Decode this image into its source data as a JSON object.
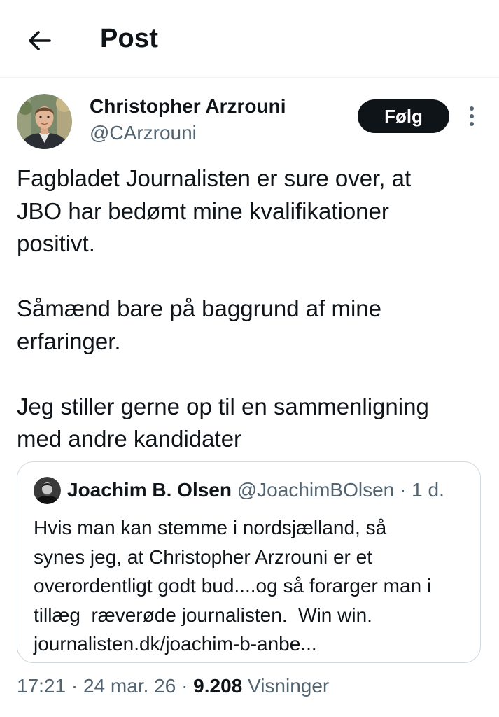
{
  "header": {
    "title": "Post",
    "back_icon": "arrow-left-icon"
  },
  "author": {
    "name": "Christopher Arzrouni",
    "handle": "@CArzrouni",
    "follow_label": "Følg",
    "more_icon": "more-vertical-icon"
  },
  "post": {
    "paragraphs": [
      {
        "lines": [
          "Fagbladet Journalisten er sure over, at",
          "JBO har bedømt mine kvalifikationer",
          "positivt."
        ]
      },
      {
        "lines": [
          "Såmænd bare på baggrund af mine",
          "erfaringer."
        ]
      },
      {
        "lines": [
          "Jeg stiller gerne op til en sammenligning",
          "med andre kandidater"
        ]
      }
    ]
  },
  "quote": {
    "name": "Joachim B. Olsen",
    "handle": "@JoachimBOlsen",
    "separator": "·",
    "time": "1 d.",
    "lines": [
      "Hvis man kan stemme i nordsjælland, så",
      "synes jeg, at Christopher Arzrouni er et",
      "overordentligt godt bud....og så forarger man i",
      "tillæg  ræverøde journalisten.  Win win.",
      "journalisten.dk/joachim-b-anbe..."
    ]
  },
  "meta": {
    "time": "17:21",
    "separator": "·",
    "date": "24 mar. 26",
    "views_count": "9.208",
    "views_label": "Visninger"
  }
}
